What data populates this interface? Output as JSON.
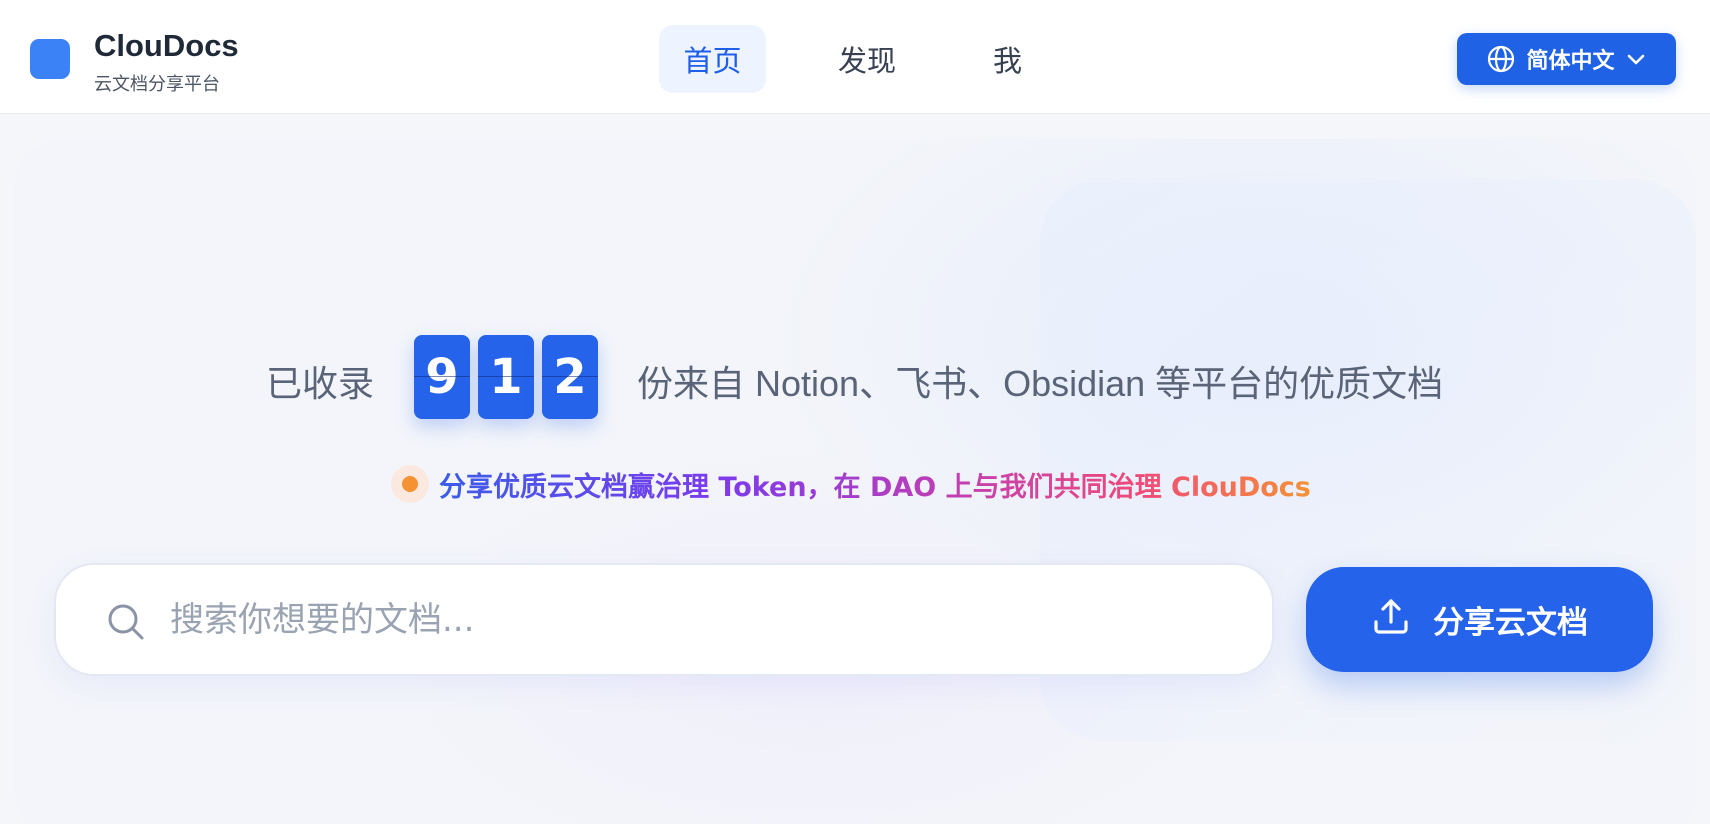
{
  "header": {
    "brand_name": "ClouDocs",
    "brand_subtitle": "云文档分享平台",
    "nav": [
      {
        "label": "首页",
        "active": true
      },
      {
        "label": "发现",
        "active": false
      },
      {
        "label": "我",
        "active": false
      }
    ],
    "language": {
      "label": "简体中文",
      "icon": "globe-icon",
      "chevron": "chevron-down-icon"
    }
  },
  "hero": {
    "stat_prefix": "已收录",
    "count_digits": [
      "9",
      "1",
      "2"
    ],
    "stat_suffix": "份来自 Notion、飞书、Obsidian 等平台的优质文档",
    "tagline": "分享优质云文档赢治理 Token，在 DAO 上与我们共同治理 ClouDocs"
  },
  "search": {
    "placeholder": "搜索你想要的文档...",
    "value": "",
    "icon": "search-icon"
  },
  "share_button": {
    "label": "分享云文档",
    "icon": "upload-icon"
  },
  "colors": {
    "primary": "#2563eb",
    "nav_active_bg": "#edf4ff",
    "nav_active_text": "#1e5ee8",
    "tag_dot": "#f59234"
  }
}
